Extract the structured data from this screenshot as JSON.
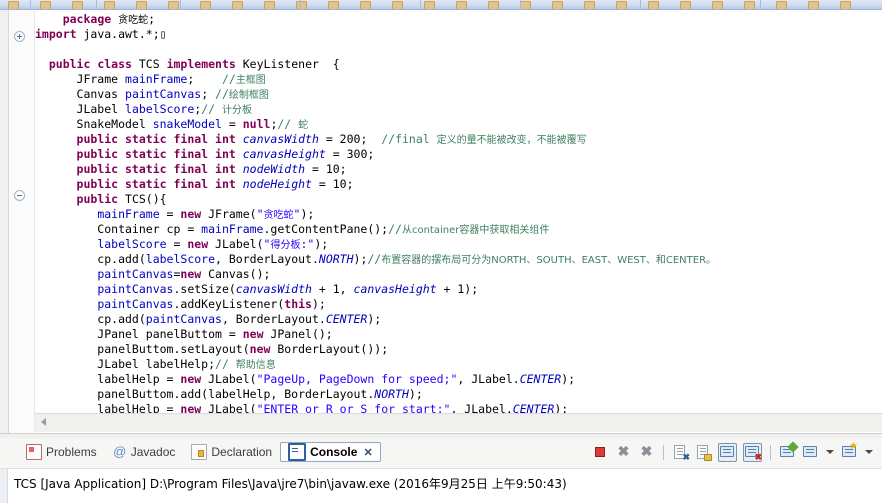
{
  "window": {
    "app": "Eclipse IDE",
    "toolbar_icon_names": [
      "save-icon",
      "print-icon",
      "debug-icon",
      "run-icon",
      "new-icon",
      "search-icon",
      "next-annotation-icon",
      "prev-annotation-icon",
      "back-icon",
      "forward-icon"
    ]
  },
  "editor": {
    "gutter": {
      "fold_markers": [
        {
          "type": "plus",
          "name": "fold-expand-import"
        },
        {
          "type": "minus",
          "name": "fold-collapse-constructor"
        }
      ]
    },
    "lines": [
      {
        "i": 0,
        "tokens": [
          {
            "t": "    ",
            "c": "plain"
          },
          {
            "t": "package",
            "c": "kw"
          },
          {
            "t": " ",
            "c": "plain"
          },
          {
            "t": "贪吃蛇",
            "c": "cjk"
          },
          {
            "t": ";",
            "c": "plain"
          }
        ]
      },
      {
        "i": 1,
        "tokens": [
          {
            "t": "",
            "c": "plain"
          },
          {
            "t": "import",
            "c": "kw"
          },
          {
            "t": " java.awt.*;",
            "c": "plain"
          },
          {
            "t": "▯",
            "c": "plain"
          }
        ]
      },
      {
        "i": 2,
        "tokens": []
      },
      {
        "i": 3,
        "tokens": [
          {
            "t": "  ",
            "c": "plain"
          },
          {
            "t": "public class",
            "c": "kw"
          },
          {
            "t": " TCS ",
            "c": "plain"
          },
          {
            "t": "implements",
            "c": "kw"
          },
          {
            "t": " KeyListener  {",
            "c": "plain"
          }
        ]
      },
      {
        "i": 4,
        "tokens": [
          {
            "t": "      JFrame ",
            "c": "plain"
          },
          {
            "t": "mainFrame",
            "c": "fld"
          },
          {
            "t": ";    ",
            "c": "plain"
          },
          {
            "t": "//",
            "c": "cmt"
          },
          {
            "t": "主框图",
            "c": "cmt cjk"
          }
        ]
      },
      {
        "i": 5,
        "tokens": [
          {
            "t": "      Canvas ",
            "c": "plain"
          },
          {
            "t": "paintCanvas",
            "c": "fld"
          },
          {
            "t": "; ",
            "c": "plain"
          },
          {
            "t": "//",
            "c": "cmt"
          },
          {
            "t": "绘制框图",
            "c": "cmt cjk"
          }
        ]
      },
      {
        "i": 6,
        "tokens": [
          {
            "t": "      JLabel ",
            "c": "plain"
          },
          {
            "t": "labelScore",
            "c": "fld"
          },
          {
            "t": ";",
            "c": "plain"
          },
          {
            "t": "// ",
            "c": "cmt"
          },
          {
            "t": "计分板",
            "c": "cmt cjk"
          }
        ]
      },
      {
        "i": 7,
        "tokens": [
          {
            "t": "      SnakeModel ",
            "c": "plain"
          },
          {
            "t": "snakeModel",
            "c": "fld"
          },
          {
            "t": " = ",
            "c": "plain"
          },
          {
            "t": "null",
            "c": "kw"
          },
          {
            "t": ";",
            "c": "plain"
          },
          {
            "t": "// ",
            "c": "cmt"
          },
          {
            "t": "蛇",
            "c": "cmt cjk"
          }
        ]
      },
      {
        "i": 8,
        "tokens": [
          {
            "t": "      ",
            "c": "plain"
          },
          {
            "t": "public static final int",
            "c": "kw"
          },
          {
            "t": " ",
            "c": "plain"
          },
          {
            "t": "canvasWidth",
            "c": "sfld"
          },
          {
            "t": " = 200;  ",
            "c": "plain"
          },
          {
            "t": "//final ",
            "c": "cmt"
          },
          {
            "t": "定义的量不能被改变，不能被覆写",
            "c": "cmt cjk"
          }
        ]
      },
      {
        "i": 9,
        "tokens": [
          {
            "t": "      ",
            "c": "plain"
          },
          {
            "t": "public static final int",
            "c": "kw"
          },
          {
            "t": " ",
            "c": "plain"
          },
          {
            "t": "canvasHeight",
            "c": "sfld"
          },
          {
            "t": " = 300;",
            "c": "plain"
          }
        ]
      },
      {
        "i": 10,
        "tokens": [
          {
            "t": "      ",
            "c": "plain"
          },
          {
            "t": "public static final int",
            "c": "kw"
          },
          {
            "t": " ",
            "c": "plain"
          },
          {
            "t": "nodeWidth",
            "c": "sfld"
          },
          {
            "t": " = 10;",
            "c": "plain"
          }
        ]
      },
      {
        "i": 11,
        "tokens": [
          {
            "t": "      ",
            "c": "plain"
          },
          {
            "t": "public static final int",
            "c": "kw"
          },
          {
            "t": " ",
            "c": "plain"
          },
          {
            "t": "nodeHeight",
            "c": "sfld"
          },
          {
            "t": " = 10;",
            "c": "plain"
          }
        ]
      },
      {
        "i": 12,
        "tokens": [
          {
            "t": "      ",
            "c": "plain"
          },
          {
            "t": "public",
            "c": "kw"
          },
          {
            "t": " TCS(){",
            "c": "plain"
          }
        ]
      },
      {
        "i": 13,
        "tokens": [
          {
            "t": "         ",
            "c": "plain"
          },
          {
            "t": "mainFrame",
            "c": "fld"
          },
          {
            "t": " = ",
            "c": "plain"
          },
          {
            "t": "new",
            "c": "kw"
          },
          {
            "t": " JFrame(",
            "c": "plain"
          },
          {
            "t": "\"",
            "c": "str"
          },
          {
            "t": "贪吃蛇",
            "c": "str cjk"
          },
          {
            "t": "\"",
            "c": "str"
          },
          {
            "t": ");",
            "c": "plain"
          }
        ]
      },
      {
        "i": 14,
        "tokens": [
          {
            "t": "         Container cp = ",
            "c": "plain"
          },
          {
            "t": "mainFrame",
            "c": "fld"
          },
          {
            "t": ".getContentPane();",
            "c": "plain"
          },
          {
            "t": "//",
            "c": "cmt"
          },
          {
            "t": "从container",
            "c": "cmt cjk"
          },
          {
            "t": "容器中获取相关组件",
            "c": "cmt cjk"
          }
        ]
      },
      {
        "i": 15,
        "tokens": [
          {
            "t": "         ",
            "c": "plain"
          },
          {
            "t": "labelScore",
            "c": "fld"
          },
          {
            "t": " = ",
            "c": "plain"
          },
          {
            "t": "new",
            "c": "kw"
          },
          {
            "t": " JLabel(",
            "c": "plain"
          },
          {
            "t": "\"",
            "c": "str"
          },
          {
            "t": "得分板",
            "c": "str cjk"
          },
          {
            "t": ":\"",
            "c": "str"
          },
          {
            "t": ");",
            "c": "plain"
          }
        ]
      },
      {
        "i": 16,
        "tokens": [
          {
            "t": "         cp.add(",
            "c": "plain"
          },
          {
            "t": "labelScore",
            "c": "fld"
          },
          {
            "t": ", BorderLayout.",
            "c": "plain"
          },
          {
            "t": "NORTH",
            "c": "stc"
          },
          {
            "t": ");",
            "c": "plain"
          },
          {
            "t": "//",
            "c": "cmt"
          },
          {
            "t": "布置容器的摆布局可分为NORTH、SOUTH、EAST、WEST、和CENTER。",
            "c": "cmt cjk"
          }
        ]
      },
      {
        "i": 17,
        "tokens": [
          {
            "t": "         ",
            "c": "plain"
          },
          {
            "t": "paintCanvas",
            "c": "fld"
          },
          {
            "t": "=",
            "c": "plain"
          },
          {
            "t": "new",
            "c": "kw"
          },
          {
            "t": " Canvas();",
            "c": "plain"
          }
        ]
      },
      {
        "i": 18,
        "tokens": [
          {
            "t": "         ",
            "c": "plain"
          },
          {
            "t": "paintCanvas",
            "c": "fld"
          },
          {
            "t": ".setSize(",
            "c": "plain"
          },
          {
            "t": "canvasWidth",
            "c": "sfld"
          },
          {
            "t": " + 1, ",
            "c": "plain"
          },
          {
            "t": "canvasHeight",
            "c": "sfld"
          },
          {
            "t": " + 1);",
            "c": "plain"
          }
        ]
      },
      {
        "i": 19,
        "tokens": [
          {
            "t": "         ",
            "c": "plain"
          },
          {
            "t": "paintCanvas",
            "c": "fld"
          },
          {
            "t": ".addKeyListener(",
            "c": "plain"
          },
          {
            "t": "this",
            "c": "kw"
          },
          {
            "t": ");",
            "c": "plain"
          }
        ]
      },
      {
        "i": 20,
        "tokens": [
          {
            "t": "         cp.add(",
            "c": "plain"
          },
          {
            "t": "paintCanvas",
            "c": "fld"
          },
          {
            "t": ", BorderLayout.",
            "c": "plain"
          },
          {
            "t": "CENTER",
            "c": "stc"
          },
          {
            "t": ");",
            "c": "plain"
          }
        ]
      },
      {
        "i": 21,
        "tokens": [
          {
            "t": "         JPanel panelButtom = ",
            "c": "plain"
          },
          {
            "t": "new",
            "c": "kw"
          },
          {
            "t": " JPanel();",
            "c": "plain"
          }
        ]
      },
      {
        "i": 22,
        "tokens": [
          {
            "t": "         panelButtom.setLayout(",
            "c": "plain"
          },
          {
            "t": "new",
            "c": "kw"
          },
          {
            "t": " BorderLayout());",
            "c": "plain"
          }
        ]
      },
      {
        "i": 23,
        "tokens": [
          {
            "t": "         JLabel labelHelp;",
            "c": "plain"
          },
          {
            "t": "// ",
            "c": "cmt"
          },
          {
            "t": "帮助信息",
            "c": "cmt cjk"
          }
        ]
      },
      {
        "i": 24,
        "tokens": [
          {
            "t": "         labelHelp = ",
            "c": "plain"
          },
          {
            "t": "new",
            "c": "kw"
          },
          {
            "t": " JLabel(",
            "c": "plain"
          },
          {
            "t": "\"PageUp, PageDown for speed;\"",
            "c": "str"
          },
          {
            "t": ", JLabel.",
            "c": "plain"
          },
          {
            "t": "CENTER",
            "c": "stc"
          },
          {
            "t": ");",
            "c": "plain"
          }
        ]
      },
      {
        "i": 25,
        "tokens": [
          {
            "t": "         panelButtom.add(labelHelp, BorderLayout.",
            "c": "plain"
          },
          {
            "t": "NORTH",
            "c": "stc"
          },
          {
            "t": ");",
            "c": "plain"
          }
        ]
      },
      {
        "i": 26,
        "tokens": [
          {
            "t": "         labelHelp = ",
            "c": "plain"
          },
          {
            "t": "new",
            "c": "kw"
          },
          {
            "t": " JLabel(",
            "c": "plain"
          },
          {
            "t": "\"ENTER or R or S for start;\"",
            "c": "str"
          },
          {
            "t": ", JLabel.",
            "c": "plain"
          },
          {
            "t": "CENTER",
            "c": "stc"
          },
          {
            "t": ");",
            "c": "plain"
          }
        ]
      }
    ]
  },
  "console_panel": {
    "tabs": [
      {
        "label": "Problems",
        "icon": "problems-icon",
        "active": false
      },
      {
        "label": "Javadoc",
        "icon": "javadoc-icon",
        "active": false
      },
      {
        "label": "Declaration",
        "icon": "declaration-icon",
        "active": false
      },
      {
        "label": "Console",
        "icon": "console-icon",
        "active": true,
        "close": "✕"
      }
    ],
    "toolbar": [
      {
        "name": "terminate-button",
        "kind": "stop"
      },
      {
        "name": "terminate-all-button",
        "kind": "x"
      },
      {
        "name": "remove-all-terminated-button",
        "kind": "x-doc"
      },
      {
        "name": "separator-1",
        "kind": "sep"
      },
      {
        "name": "clear-console-button",
        "kind": "clear"
      },
      {
        "name": "scroll-lock-button",
        "kind": "lock"
      },
      {
        "name": "show-console-on-output-button",
        "kind": "monitor",
        "boxed": true
      },
      {
        "name": "show-console-on-error-button",
        "kind": "monitor-error",
        "boxed": true
      },
      {
        "name": "separator-2",
        "kind": "sep"
      },
      {
        "name": "pin-console-button",
        "kind": "pin"
      },
      {
        "name": "display-selected-console-button",
        "kind": "display"
      },
      {
        "name": "display-selected-console-menu",
        "kind": "arrow"
      },
      {
        "name": "open-console-button",
        "kind": "open"
      },
      {
        "name": "open-console-menu",
        "kind": "arrow"
      }
    ],
    "status_text": "TCS [Java Application] D:\\Program Files\\Java\\jre7\\bin\\javaw.exe (2016年9月25日 上午9:50:43)"
  },
  "colors": {
    "keyword": "#7f0055",
    "field": "#0000c0",
    "string": "#2a00ff",
    "comment": "#3f7f5f",
    "tab_active_border": "#8fa8c4",
    "stop_red": "#d93a3a"
  }
}
